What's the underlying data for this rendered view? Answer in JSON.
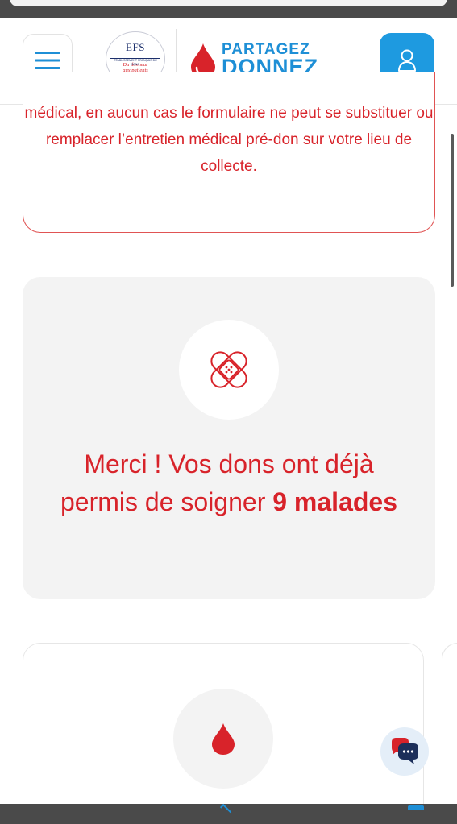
{
  "header": {
    "efs_logo_text": "EFS",
    "efs_logo_subtitle": "ÉTABLISSEMENT FRANÇAIS DU SANG",
    "efs_tagline_line1": "Du donneur",
    "efs_tagline_line2": "aux patients",
    "brand_line1": "PARTAGEZ",
    "brand_line2": "DONNEZ"
  },
  "notice": {
    "text": "médical, en aucun cas le formulaire ne peut se substituer ou remplacer l’entretien médical pré-don sur votre lieu de collecte."
  },
  "thanks_card": {
    "text_prefix": "Merci ! Vos dons ont déjà permis de soigner",
    "count": "9",
    "suffix": "malades"
  },
  "colors": {
    "brand_red": "#d8232a",
    "brand_blue": "#1e8fd6",
    "account_blue": "#1e9ae0"
  },
  "icons": {
    "menu": "hamburger-menu-icon",
    "account": "user-icon",
    "bandage": "bandage-icon",
    "blood_drop": "blood-drop-icon",
    "chat": "chat-icon"
  }
}
